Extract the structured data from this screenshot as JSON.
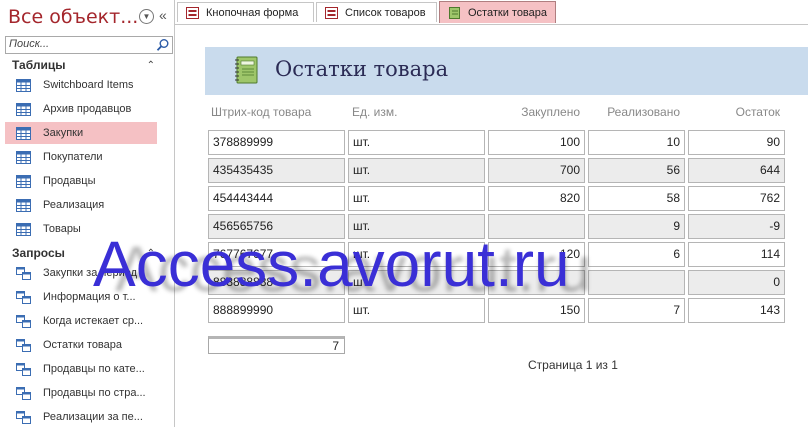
{
  "nav": {
    "title": "Все объект...",
    "search_placeholder": "Поиск...",
    "groups": [
      {
        "title": "Таблицы",
        "items": [
          {
            "label": "Switchboard Items",
            "icon": "table-icon",
            "selected": false
          },
          {
            "label": "Архив продавцов",
            "icon": "table-icon",
            "selected": false
          },
          {
            "label": "Закупки",
            "icon": "table-icon",
            "selected": true
          },
          {
            "label": "Покупатели",
            "icon": "table-icon",
            "selected": false
          },
          {
            "label": "Продавцы",
            "icon": "table-icon",
            "selected": false
          },
          {
            "label": "Реализация",
            "icon": "table-icon",
            "selected": false
          },
          {
            "label": "Товары",
            "icon": "table-icon",
            "selected": false
          }
        ]
      },
      {
        "title": "Запросы",
        "items": [
          {
            "label": "Закупки за период",
            "icon": "query-icon",
            "selected": false
          },
          {
            "label": "Информация о т...",
            "icon": "query-icon",
            "selected": false
          },
          {
            "label": "Когда истекает ср...",
            "icon": "query-icon",
            "selected": false
          },
          {
            "label": "Остатки товара",
            "icon": "query-icon",
            "selected": false
          },
          {
            "label": "Продавцы по кате...",
            "icon": "query-icon",
            "selected": false
          },
          {
            "label": "Продавцы по стра...",
            "icon": "query-icon",
            "selected": false
          },
          {
            "label": "Реализации за пе...",
            "icon": "query-icon",
            "selected": false
          }
        ]
      }
    ]
  },
  "tabs": [
    {
      "label": "Кнопочная форма",
      "icon": "form-icon",
      "active": false
    },
    {
      "label": "Список товаров",
      "icon": "form-icon",
      "active": false
    },
    {
      "label": "Остатки товара",
      "icon": "report-icon",
      "active": true
    }
  ],
  "report": {
    "title": "Остатки товара",
    "columns": [
      "Штрих-код товара",
      "Ед. изм.",
      "Закуплено",
      "Реализовано",
      "Остаток"
    ],
    "rows": [
      [
        "378889999",
        "шт.",
        "100",
        "10",
        "90"
      ],
      [
        "435435435",
        "шт.",
        "700",
        "56",
        "644"
      ],
      [
        "454443444",
        "шт.",
        "820",
        "58",
        "762"
      ],
      [
        "456565756",
        "шт.",
        "",
        "9",
        "-9"
      ],
      [
        "767767677",
        "шт.",
        "120",
        "6",
        "114"
      ],
      [
        "888888888",
        "шт.",
        "",
        "",
        "0"
      ],
      [
        "888899990",
        "шт.",
        "150",
        "7",
        "143"
      ]
    ],
    "count": "7",
    "page_info": "Страница 1 из 1"
  },
  "watermark": "Access.avorut.ru",
  "colors": {
    "accent": "#a4262c",
    "selected_bg": "#f5c1c4",
    "banner_bg": "#c9dbed",
    "watermark": "#3a2fd6"
  }
}
